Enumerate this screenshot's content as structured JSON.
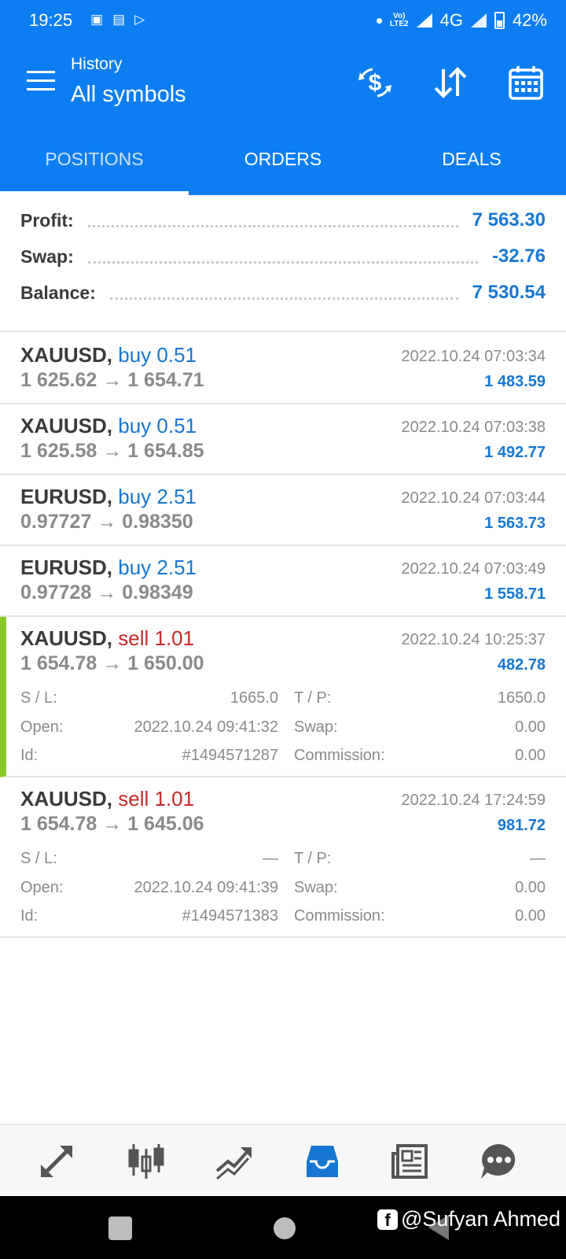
{
  "status": {
    "time": "19:25",
    "network": "4G",
    "volte": "Vo LTE2",
    "battery": "42%"
  },
  "appbar": {
    "subtitle": "History",
    "title": "All symbols"
  },
  "tabs": [
    "POSITIONS",
    "ORDERS",
    "DEALS"
  ],
  "summary": {
    "profit_label": "Profit:",
    "profit": "7 563.30",
    "swap_label": "Swap:",
    "swap": "-32.76",
    "balance_label": "Balance:",
    "balance": "7 530.54"
  },
  "positions": [
    {
      "symbol": "XAUUSD,",
      "dir": "buy 0.51",
      "prices": "1 625.62 → 1 654.71",
      "date": "2022.10.24 07:03:34",
      "profit": "1 483.59"
    },
    {
      "symbol": "XAUUSD,",
      "dir": "buy 0.51",
      "prices": "1 625.58 → 1 654.85",
      "date": "2022.10.24 07:03:38",
      "profit": "1 492.77"
    },
    {
      "symbol": "EURUSD,",
      "dir": "buy 2.51",
      "prices": "0.97727 → 0.98350",
      "date": "2022.10.24 07:03:44",
      "profit": "1 563.73"
    },
    {
      "symbol": "EURUSD,",
      "dir": "buy 2.51",
      "prices": "0.97728 → 0.98349",
      "date": "2022.10.24 07:03:49",
      "profit": "1 558.71"
    },
    {
      "symbol": "XAUUSD,",
      "dir": "sell 1.01",
      "prices": "1 654.78 → 1 650.00",
      "date": "2022.10.24 10:25:37",
      "profit": "482.78",
      "sl_label": "S / L:",
      "sl": "1665.0",
      "tp_label": "T / P:",
      "tp": "1650.0",
      "open_label": "Open:",
      "open": "2022.10.24 09:41:32",
      "swap_label": "Swap:",
      "swap": "0.00",
      "id_label": "Id:",
      "id": "#1494571287",
      "commission_label": "Commission:",
      "commission": "0.00"
    },
    {
      "symbol": "XAUUSD,",
      "dir": "sell 1.01",
      "prices": "1 654.78 → 1 645.06",
      "date": "2022.10.24 17:24:59",
      "profit": "981.72",
      "sl_label": "S / L:",
      "sl": "—",
      "tp_label": "T / P:",
      "tp": "—",
      "open_label": "Open:",
      "open": "2022.10.24 09:41:39",
      "swap_label": "Swap:",
      "swap": "0.00",
      "id_label": "Id:",
      "id": "#1494571383",
      "commission_label": "Commission:",
      "commission": "0.00"
    }
  ],
  "watermark": "@Sufyan Ahmed",
  "colors": {
    "primary": "#0d7ef1",
    "buy": "#1677d2",
    "sell": "#c62828",
    "selected": "#8ac925"
  }
}
